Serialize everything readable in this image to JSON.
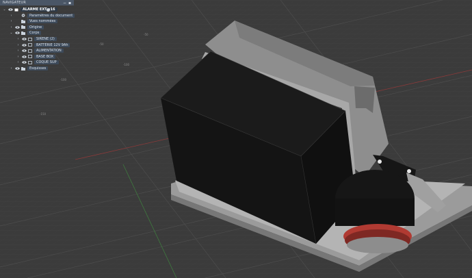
{
  "navigator": {
    "title": "NAVIGATEUR",
    "minus_icon": "minus-icon",
    "tree": [
      {
        "label": "ALARME EXT v16",
        "level": 0,
        "expanded": true,
        "has_eye": true,
        "icon": "component-icon",
        "settings": true,
        "strong": true
      },
      {
        "label": "Paramètres du document",
        "level": 1,
        "expanded": false,
        "has_eye": false,
        "icon": "gear-icon"
      },
      {
        "label": "Vues nommées",
        "level": 1,
        "expanded": false,
        "has_eye": false,
        "icon": "folder-icon"
      },
      {
        "label": "Origine",
        "level": 1,
        "expanded": false,
        "has_eye": true,
        "icon": "folder-icon"
      },
      {
        "label": "Corps",
        "level": 1,
        "expanded": true,
        "has_eye": true,
        "icon": "folder-icon"
      },
      {
        "label": "SIRENE (2)",
        "level": 2,
        "expanded": false,
        "has_eye": true,
        "icon": "body-icon"
      },
      {
        "label": "BATTERIE 12V 9Ah",
        "level": 2,
        "expanded": false,
        "has_eye": true,
        "icon": "body-icon"
      },
      {
        "label": "ALIMENTATION",
        "level": 2,
        "expanded": false,
        "has_eye": true,
        "icon": "body-icon"
      },
      {
        "label": "BASE BOX",
        "level": 2,
        "expanded": false,
        "has_eye": true,
        "icon": "body-icon"
      },
      {
        "label": "COQUE SUP",
        "level": 2,
        "expanded": false,
        "has_eye": true,
        "icon": "body-icon"
      },
      {
        "label": "Esquisses",
        "level": 1,
        "expanded": false,
        "has_eye": true,
        "icon": "folder-icon"
      }
    ]
  },
  "viewport": {
    "background_color": "#3b3b3b",
    "axis_x_color": "#8a3a3a",
    "axis_y_color": "#3f7a3f",
    "siren_accent_color": "#b03a32",
    "grid_labels": [
      "-50",
      "-100",
      "-150",
      "-50",
      "-100",
      "50"
    ]
  }
}
